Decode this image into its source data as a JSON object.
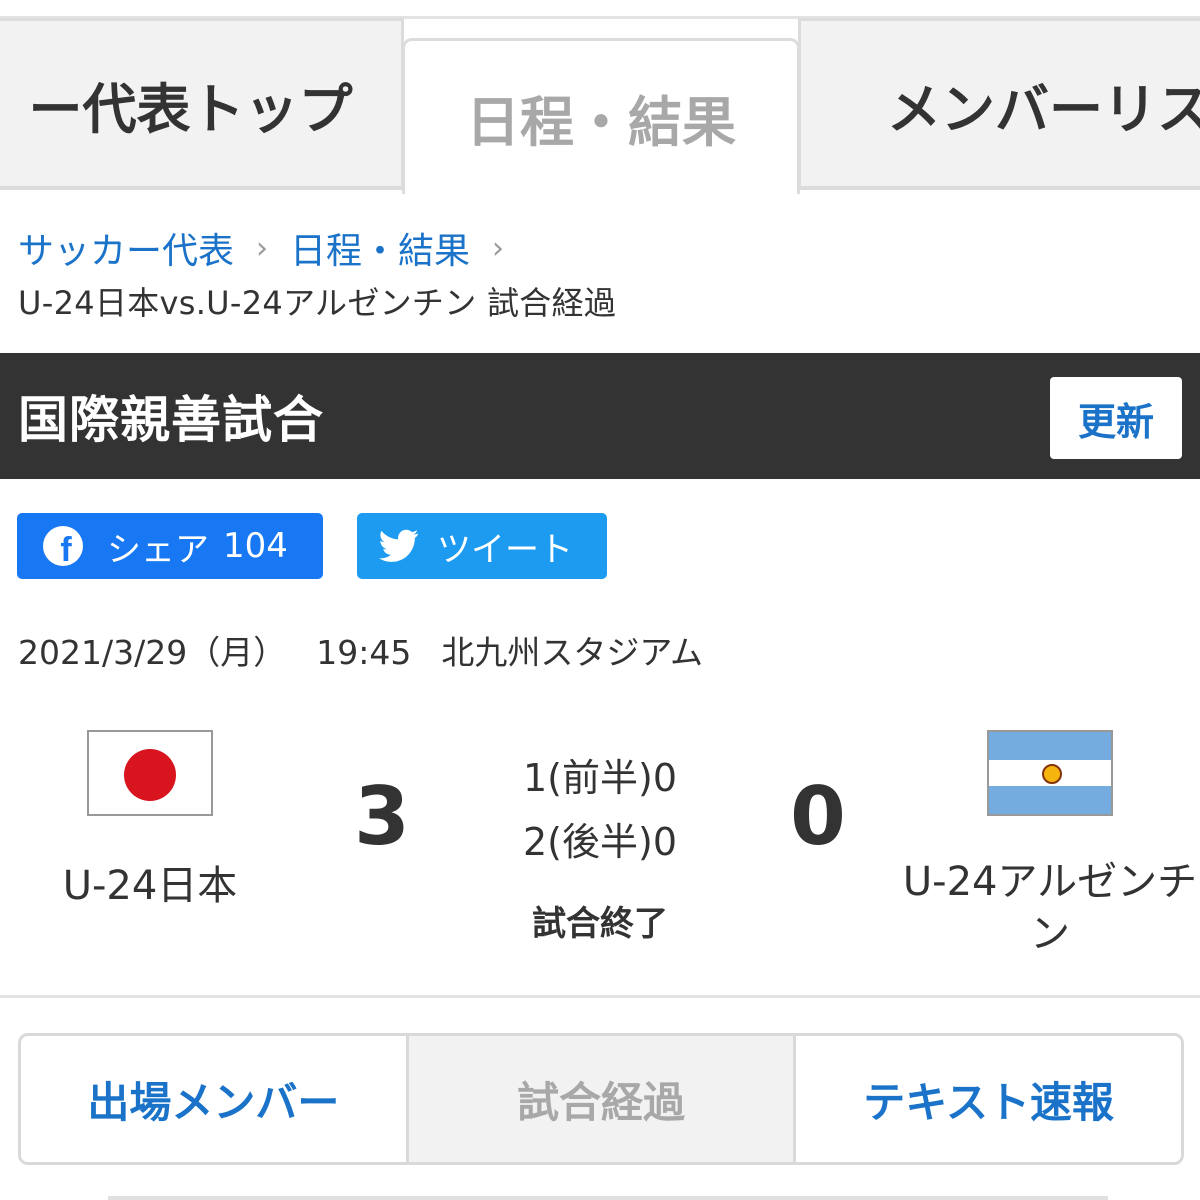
{
  "top_tabs": [
    {
      "label": "ー代表トップ",
      "active": false
    },
    {
      "label": "日程・結果",
      "active": true
    },
    {
      "label": "メンバーリス",
      "active": false
    }
  ],
  "breadcrumb": {
    "items": [
      "サッカー代表",
      "日程・結果"
    ],
    "current": "U-24日本vs.U-24アルゼンチン 試合経過"
  },
  "competition": {
    "title": "国際親善試合",
    "refresh_label": "更新"
  },
  "social": {
    "facebook_label": "シェア",
    "facebook_count": "104",
    "twitter_label": "ツイート",
    "facebook_icon": "facebook-icon",
    "twitter_icon": "twitter-bird-icon"
  },
  "match": {
    "date": "2021/3/29（月）",
    "time": "19:45",
    "venue": "北九州スタジアム",
    "home": {
      "name": "U-24日本",
      "score": "3",
      "flag": "japan-flag-icon"
    },
    "away": {
      "name": "U-24アルゼンチン",
      "score": "0",
      "flag": "argentina-flag-icon"
    },
    "halves": [
      {
        "home": "1",
        "label": "(前半)",
        "away": "0"
      },
      {
        "home": "2",
        "label": "(後半)",
        "away": "0"
      }
    ],
    "status": "試合終了"
  },
  "sub_tabs": [
    {
      "label": "出場メンバー",
      "active": false
    },
    {
      "label": "試合経過",
      "active": true
    },
    {
      "label": "テキスト速報",
      "active": false
    }
  ],
  "colors": {
    "link_blue": "#1a73c8",
    "header_dark": "#333333",
    "facebook_blue": "#1877f2",
    "twitter_blue": "#1d9bf0",
    "inactive_gray": "#a8a8a8"
  }
}
